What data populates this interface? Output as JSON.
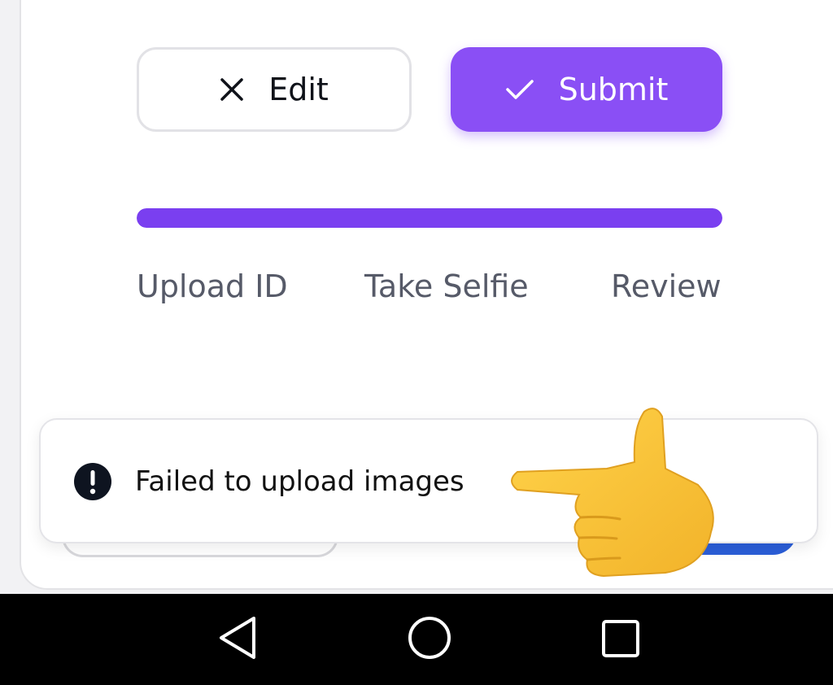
{
  "actions": {
    "edit_label": "Edit",
    "edit_icon": "close-icon",
    "submit_label": "Submit",
    "submit_icon": "check-icon"
  },
  "progress": {
    "value_percent": 100,
    "steps": [
      "Upload ID",
      "Take Selfie",
      "Review"
    ]
  },
  "toast": {
    "message": "Failed to upload images",
    "icon": "alert-circle-icon"
  },
  "overlay": {
    "icon": "pointing-hand-emoji"
  },
  "navbar": {
    "back_icon": "back-triangle-icon",
    "home_icon": "home-circle-icon",
    "recents_icon": "recents-square-icon"
  },
  "colors": {
    "accent": "#8a4ff5",
    "progress": "#7a3ff0",
    "text_muted": "#565a68",
    "toast_icon": "#0e1420"
  }
}
